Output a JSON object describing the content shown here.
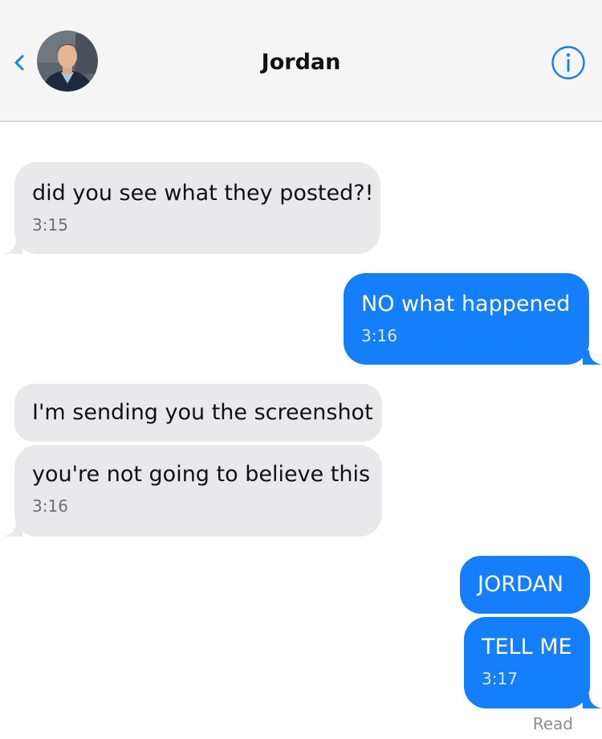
{
  "header": {
    "contact_name": "Jordan"
  },
  "messages": [
    {
      "direction": "incoming",
      "text": "did you see what they posted?!",
      "time": "3:15"
    },
    {
      "direction": "outgoing",
      "text": "NO what happened",
      "time": "3:16"
    },
    {
      "direction": "incoming",
      "text": "I'm sending you the screenshot"
    },
    {
      "direction": "incoming",
      "text": "you're not going to believe this",
      "time": "3:16"
    },
    {
      "direction": "outgoing",
      "text": "JORDAN"
    },
    {
      "direction": "outgoing",
      "text": "TELL ME",
      "time": "3:17"
    }
  ],
  "status": {
    "read_label": "Read"
  },
  "colors": {
    "accent": "#147efb",
    "incoming_bubble": "#e9e9eb",
    "header_bg": "#f5f5f5"
  }
}
